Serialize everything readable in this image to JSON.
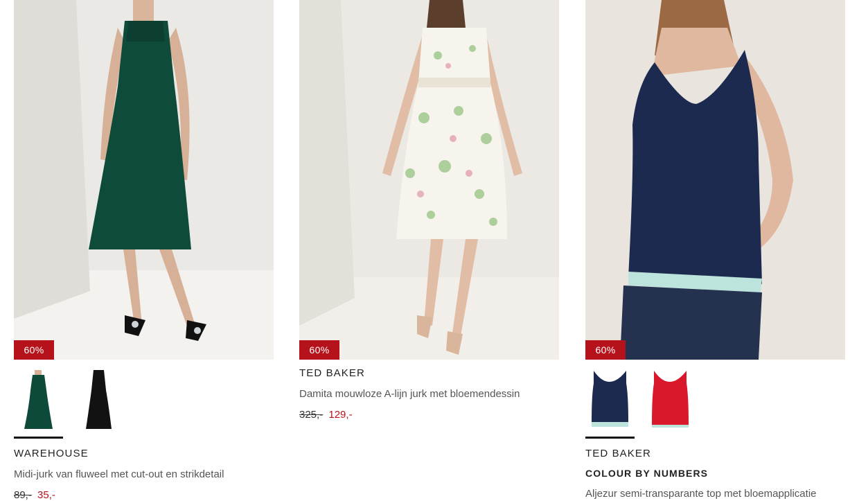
{
  "products": [
    {
      "discount_badge": "60%",
      "brand": "WAREHOUSE",
      "title": "Midi-jurk van fluweel met cut-out en strikdetail",
      "old_price": "89,-",
      "new_price": "35,-",
      "swatches": [
        {
          "color": "green",
          "hex": "#0e4a3a"
        },
        {
          "color": "black",
          "hex": "#121212"
        }
      ]
    },
    {
      "discount_badge": "60%",
      "brand": "TED BAKER",
      "title": "Damita mouwloze A-lijn jurk met bloemendessin",
      "old_price": "325,-",
      "new_price": "129,-"
    },
    {
      "discount_badge": "60%",
      "brand": "TED BAKER",
      "sub_brand": "COLOUR BY NUMBERS",
      "title": "Aljezur semi-transparante top met bloemapplicatie",
      "swatches": [
        {
          "color": "navy",
          "hex": "#1c2a4f"
        },
        {
          "color": "red",
          "hex": "#d9182b"
        }
      ]
    }
  ],
  "colors": {
    "accent_red": "#b5121b",
    "badge_text": "#ffffff",
    "text_dark": "#222222",
    "text_muted": "#555555"
  }
}
